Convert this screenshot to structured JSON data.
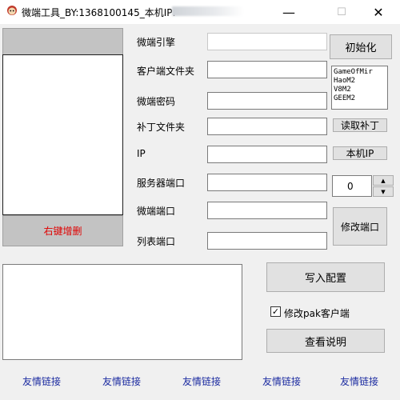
{
  "window": {
    "title": "微端工具_BY:1368100145_本机IP:",
    "minimize": "—",
    "maximize": "☐",
    "close": "✕"
  },
  "sidebar": {
    "action_label": "右键增删"
  },
  "form": {
    "engine_label": "微端引擎",
    "client_folder_label": "客户端文件夹",
    "password_label": "微端密码",
    "patch_folder_label": "补丁文件夹",
    "ip_label": "IP",
    "server_port_label": "服务器端口",
    "micro_port_label": "微端端口",
    "list_port_label": "列表端口"
  },
  "buttons": {
    "init": "初始化",
    "read_patch": "读取补丁",
    "local_ip": "本机IP",
    "modify_port": "修改端口",
    "write_config": "写入配置",
    "view_help": "查看说明"
  },
  "engines": [
    "GameOfMir",
    "HaoM2",
    "V8M2",
    "GEEM2"
  ],
  "spinner": {
    "value": "0"
  },
  "pak_checkbox": {
    "label": "修改pak客户端",
    "checked": true,
    "mark": "✓"
  },
  "links": [
    "友情链接",
    "友情链接",
    "友情链接",
    "友情链接",
    "友情链接"
  ],
  "colors": {
    "link": "#1a2aa0",
    "sidebar_action": "#e00000"
  }
}
